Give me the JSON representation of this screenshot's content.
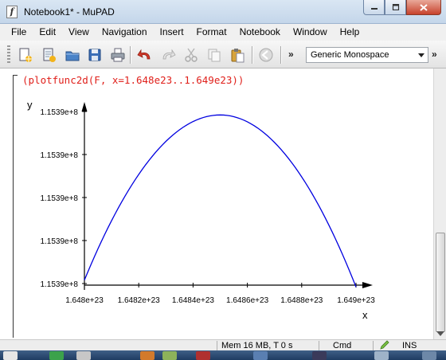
{
  "window": {
    "title": "Notebook1* - MuPAD",
    "app_icon": "mupad-notebook-icon",
    "buttons": {
      "minimize": "minimize-icon",
      "maximize": "maximize-icon",
      "close": "close-icon"
    }
  },
  "menubar": {
    "items": [
      "File",
      "Edit",
      "View",
      "Navigation",
      "Insert",
      "Format",
      "Notebook",
      "Window",
      "Help"
    ]
  },
  "toolbar": {
    "buttons": [
      {
        "name": "new-notebook-icon"
      },
      {
        "name": "new-editor-icon"
      },
      {
        "name": "open-icon"
      },
      {
        "name": "save-icon"
      },
      {
        "name": "print-icon"
      },
      {
        "name": "undo-icon"
      },
      {
        "name": "redo-icon"
      },
      {
        "name": "cut-icon"
      },
      {
        "name": "copy-icon"
      },
      {
        "name": "paste-icon"
      },
      {
        "name": "stop-evaluation-icon"
      }
    ],
    "overflow_label": "»",
    "font_select_value": "Generic Monospace"
  },
  "notebook": {
    "input": "(plotfunc2d(F, x=1.648e23..1.649e23))"
  },
  "chart_data": {
    "type": "line",
    "xlabel": "x",
    "ylabel": "y",
    "xlim": [
      1.648e+23,
      1.649e+23
    ],
    "x_ticks": [
      "1.648e+23",
      "1.6482e+23",
      "1.6484e+23",
      "1.6486e+23",
      "1.6488e+23",
      "1.649e+23"
    ],
    "y_ticks": [
      "1.1539e+8",
      "1.1539e+8",
      "1.1539e+8",
      "1.1539e+8",
      "1.1539e+8"
    ],
    "y_tick_levels": [
      0,
      0.25,
      0.5,
      0.75,
      1.0
    ],
    "curve": {
      "shape": "downward parabola",
      "x": [
        1.648e+23,
        1.64825e+23,
        1.6485e+23,
        1.64875e+23,
        1.649e+23
      ],
      "level": [
        0.02,
        0.74,
        0.98,
        0.74,
        -0.02
      ],
      "peak_x": 1.6485e+23,
      "color": "#0000e0"
    },
    "axis_color": "#000000"
  },
  "statusbar": {
    "memory": "Mem 16 MB, T 0 s",
    "mode": "Cmd",
    "insert": "INS"
  }
}
